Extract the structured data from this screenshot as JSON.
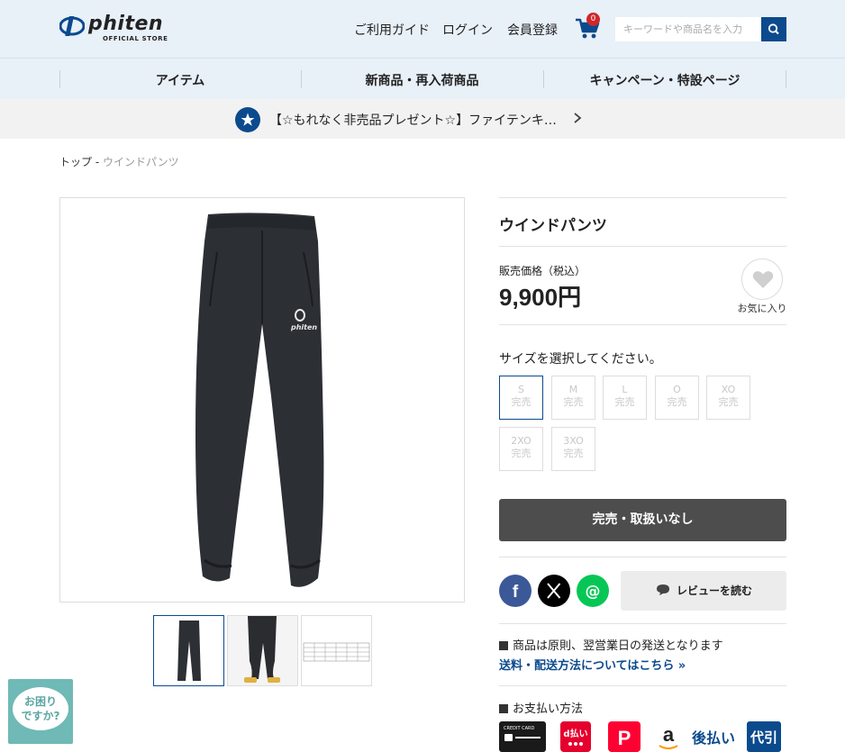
{
  "header": {
    "logo_text": "phiten",
    "logo_sub": "OFFICIAL STORE",
    "nav_guide": "ご利用ガイド",
    "nav_login": "ログイン",
    "nav_register": "会員登録",
    "cart_count": "0",
    "search_placeholder": "キーワードや商品名を入力"
  },
  "mainnav": {
    "items": [
      {
        "label": "アイテム"
      },
      {
        "label": "新商品・再入荷商品"
      },
      {
        "label": "キャンペーン・特設ページ"
      }
    ]
  },
  "promo": {
    "text": "【☆もれなく非売品プレゼント☆】ファイテンキ…"
  },
  "breadcrumb": {
    "top": "トップ",
    "separator": " - ",
    "current": "ウインドパンツ"
  },
  "product": {
    "name": "ウインドパンツ",
    "price_label": "販売価格（税込）",
    "price": "9,900円",
    "favorite_label": "お気に入り",
    "size_prompt": "サイズを選択してください。",
    "sizes": [
      {
        "name": "S",
        "status": "完売"
      },
      {
        "name": "M",
        "status": "完売"
      },
      {
        "name": "L",
        "status": "完売"
      },
      {
        "name": "O",
        "status": "完売"
      },
      {
        "name": "XO",
        "status": "完売"
      },
      {
        "name": "2XO",
        "status": "完売"
      },
      {
        "name": "3XO",
        "status": "完売"
      }
    ],
    "soldout_button": "完売・取扱いなし",
    "review_button": "レビューを読む",
    "shipping_notice": "商品は原則、翌営業日の発送となります",
    "shipping_link": "送料・配送方法についてはこちら »",
    "payment_heading": "お支払い方法",
    "payment_methods": [
      {
        "label": "CREDIT CARD",
        "icon": "credit-card-icon"
      },
      {
        "label": "d払い",
        "icon": "d-barai-icon"
      },
      {
        "label": "P",
        "icon": "paypay-icon"
      },
      {
        "label": "a",
        "icon": "amazon-pay-icon"
      },
      {
        "label": "後払い",
        "icon": "atobarai-icon"
      },
      {
        "label": "代引",
        "icon": "daibiki-icon"
      }
    ]
  },
  "help": {
    "line1": "お困り",
    "line2": "ですか?"
  },
  "colors": {
    "brand_blue": "#0b4a8d",
    "header_bg": "#e8f0f8",
    "badge_red": "#d0262b",
    "soldout_bg": "#4d4d4d"
  }
}
